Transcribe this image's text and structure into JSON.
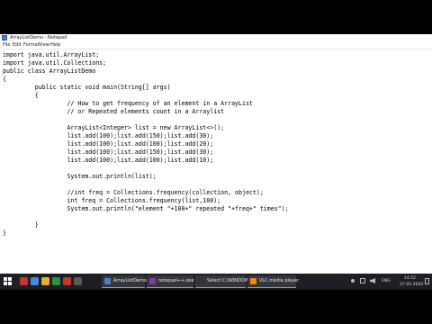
{
  "window": {
    "title": "ArrayListDemo - Notepad",
    "menu": [
      "File",
      "Edit",
      "Format",
      "View",
      "Help"
    ]
  },
  "code_lines": [
    "import java.util.ArrayList;",
    "import java.util.Collections;",
    "public class ArrayListDemo",
    "{",
    "         public static void main(String[] args)",
    "         {",
    "                  // How to get frequency of an element in a ArrayList",
    "                  // or Repeated elements count in a Arraylist",
    "",
    "                  ArrayList<Integer> list = new ArrayList<>();",
    "                  list.add(100);list.add(150);list.add(30);",
    "                  list.add(100);list.add(100);list.add(20);",
    "                  list.add(100);list.add(150);list.add(30);",
    "                  list.add(100);list.add(100);list.add(10);",
    "",
    "                  System.out.println(list);",
    "",
    "                  //int freq = Collections.frequency(collection, object);",
    "                  int freq = Collections.frequency(list,100);",
    "                  System.out.println(\"element \"+100+\" repeated \"+freq+\" times\");",
    "",
    "         }",
    "}"
  ],
  "taskbar": {
    "apps": [
      {
        "label": "ArrayListDemo - N...",
        "color": "#4a7fc1"
      },
      {
        "label": "notepad++.exe 2.0.2",
        "color": "#7a3fa0"
      },
      {
        "label": "Select C:\\WINDOW...",
        "color": "#333333"
      },
      {
        "label": "VLC media player",
        "color": "#f08a00"
      }
    ],
    "pinned_colors": [
      "#d03030",
      "#3a8fd8",
      "#e8b02a",
      "#2f8f3a",
      "#c0392b",
      "#5a5a5a"
    ],
    "tray": {
      "lang": "ENG",
      "time": "14:52",
      "date": "27-05-2020"
    }
  }
}
